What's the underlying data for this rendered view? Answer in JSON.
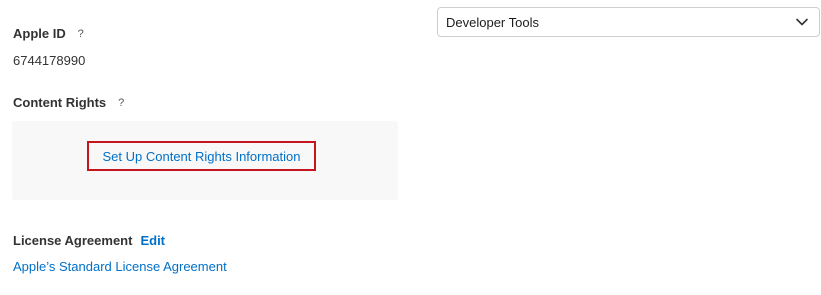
{
  "category": {
    "selected": "Developer Tools"
  },
  "apple_id": {
    "label": "Apple ID",
    "help": "?",
    "value": "6744178990"
  },
  "content_rights": {
    "label": "Content Rights",
    "help": "?",
    "link": "Set Up Content Rights Information"
  },
  "license": {
    "label": "License Agreement",
    "edit": "Edit",
    "link": "Apple’s Standard License Agreement"
  },
  "colors": {
    "link": "#0070c9",
    "highlight": "#c4161c",
    "box_bg": "#f8f8f8"
  },
  "icons": {
    "help": "question-mark-icon",
    "dropdown": "chevron-down-icon"
  }
}
